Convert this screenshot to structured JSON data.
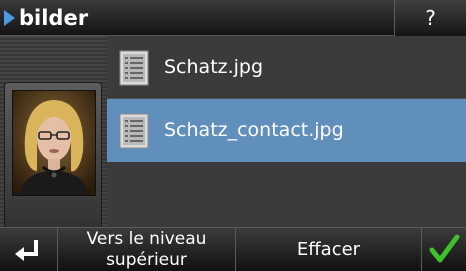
{
  "header": {
    "title": "bilder",
    "help_label": "?"
  },
  "portrait": {
    "icon": "contact-photo"
  },
  "files": [
    {
      "name": "Schatz.jpg",
      "selected": false,
      "icon": "document-icon"
    },
    {
      "name": "Schatz_contact.jpg",
      "selected": true,
      "icon": "document-icon"
    }
  ],
  "toolbar": {
    "back_icon": "return-arrow-icon",
    "up_level_line1": "Vers le niveau",
    "up_level_line2": "supérieur",
    "erase_label": "Effacer",
    "ok_icon": "checkmark-icon"
  },
  "colors": {
    "accent": "#4a9be0",
    "selection": "#5f8fba",
    "confirm": "#3fbf2c"
  }
}
